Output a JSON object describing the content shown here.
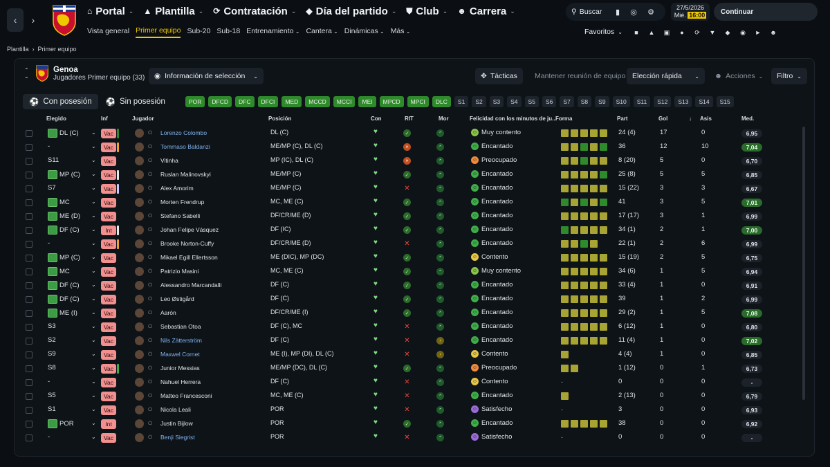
{
  "nav": {
    "main": [
      {
        "icon": "home-icon",
        "label": "Portal"
      },
      {
        "icon": "shirt-icon",
        "label": "Plantilla"
      },
      {
        "icon": "refresh-icon",
        "label": "Contratación"
      },
      {
        "icon": "diamond-icon",
        "label": "Día del partido"
      },
      {
        "icon": "shield-icon",
        "label": "Club"
      },
      {
        "icon": "person-icon",
        "label": "Carrera"
      }
    ],
    "sub": [
      "Vista general",
      "Primer equipo",
      "Sub-20",
      "Sub-18",
      "Entrenamiento",
      "Cantera",
      "Dinámicas",
      "Más"
    ],
    "sub_dropdown": [
      "Entrenamiento",
      "Cantera",
      "Dinámicas",
      "Más"
    ],
    "search": "Buscar",
    "date": "27/5/2026",
    "day": "Mié.",
    "time": "16:00",
    "continue": "Continuar",
    "favs": "Favoritos"
  },
  "breadcrumb": [
    "Plantilla",
    "Primer equipo"
  ],
  "club": {
    "name": "Genoa",
    "subtitle": "Jugadores Primer equipo (33)"
  },
  "toolbar": {
    "selinfo": "Información de selección",
    "tacticas": "Tácticas",
    "reunion": "Mantener reunión de equipo",
    "eleccion": "Elección rápida",
    "acciones": "Acciones",
    "filtro": "Filtro"
  },
  "tabs": [
    "Con posesión",
    "Sin posesión"
  ],
  "positions": [
    {
      "l": "POR",
      "on": true
    },
    {
      "l": "DFCD",
      "on": true
    },
    {
      "l": "DFC",
      "on": true
    },
    {
      "l": "DFCI",
      "on": true
    },
    {
      "l": "MED",
      "on": true
    },
    {
      "l": "MCCD",
      "on": true
    },
    {
      "l": "MCCI",
      "on": true
    },
    {
      "l": "MEI",
      "on": true
    },
    {
      "l": "MPCD",
      "on": true
    },
    {
      "l": "MPCI",
      "on": true
    },
    {
      "l": "DLC",
      "on": true
    },
    {
      "l": "S1",
      "on": false
    },
    {
      "l": "S2",
      "on": false
    },
    {
      "l": "S3",
      "on": false
    },
    {
      "l": "S4",
      "on": false
    },
    {
      "l": "S5",
      "on": false
    },
    {
      "l": "S6",
      "on": false
    },
    {
      "l": "S7",
      "on": false
    },
    {
      "l": "S8",
      "on": false
    },
    {
      "l": "S9",
      "on": false
    },
    {
      "l": "S10",
      "on": false
    },
    {
      "l": "S11",
      "on": false
    },
    {
      "l": "S12",
      "on": false
    },
    {
      "l": "S13",
      "on": false
    },
    {
      "l": "S14",
      "on": false
    },
    {
      "l": "S15",
      "on": false
    }
  ],
  "columns": {
    "elegido": "Elegido",
    "inf": "Inf",
    "jugador": "Jugador",
    "posicion": "Posición",
    "con": "Con",
    "rit": "RIT",
    "mor": "Mor",
    "felicidad": "Felicidad con los minutos de ju...",
    "forma": "Forma",
    "part": "Part",
    "gol": "Gol",
    "asis": "Asis",
    "med": "Med."
  },
  "colors": {
    "accent": "#f0c800",
    "green": "#2f8a2b",
    "inf": "#f28f8f"
  },
  "players": [
    {
      "sel": "DL (C)",
      "kit": true,
      "inf": "Vac",
      "bar": "#2f8a2b",
      "name": "Lorenzo Colombo",
      "link": true,
      "pos": "DL (C)",
      "rit": "ok",
      "mor": "up",
      "fel": "Muy contento",
      "fc": "#8bc34a",
      "form": [
        "a",
        "a",
        "a",
        "a",
        "a"
      ],
      "part": "24 (4)",
      "gol": "17",
      "asis": "0",
      "med": "6,95",
      "hi": false
    },
    {
      "sel": "-",
      "kit": false,
      "inf": "Vac",
      "bar": "#f0a030",
      "name": "Tommaso Baldanzi",
      "link": true,
      "pos": "ME/MP (C), DL (C)",
      "rit": "or",
      "mor": "up",
      "fel": "Encantado",
      "fc": "#3fae49",
      "form": [
        "a",
        "a",
        "g",
        "a",
        "g"
      ],
      "part": "36",
      "gol": "12",
      "asis": "10",
      "med": "7,04",
      "hi": true
    },
    {
      "sel": "S11",
      "kit": false,
      "inf": "Vac",
      "bar": "",
      "name": "Vitinha",
      "link": false,
      "pos": "MP (IC), DL (C)",
      "rit": "or",
      "mor": "up",
      "fel": "Preocupado",
      "fc": "#f08a3c",
      "form": [
        "a",
        "a",
        "g",
        "a",
        "a"
      ],
      "part": "8 (20)",
      "gol": "5",
      "asis": "0",
      "med": "6,70",
      "hi": false
    },
    {
      "sel": "MP (C)",
      "kit": true,
      "inf": "Vac",
      "bar": "#e8e8e8",
      "name": "Ruslan Malinovskyi",
      "link": false,
      "pos": "ME/MP (C)",
      "rit": "ok",
      "mor": "up",
      "fel": "Encantado",
      "fc": "#3fae49",
      "form": [
        "a",
        "a",
        "a",
        "a",
        "g"
      ],
      "part": "25 (8)",
      "gol": "5",
      "asis": "5",
      "med": "6,85",
      "hi": false
    },
    {
      "sel": "S7",
      "kit": false,
      "inf": "Vac",
      "bar": "#c9c9ff",
      "name": "Alex Amorim",
      "link": false,
      "pos": "ME/MP (C)",
      "rit": "no",
      "mor": "up",
      "fel": "Encantado",
      "fc": "#3fae49",
      "form": [
        "a",
        "a",
        "a",
        "a",
        "a"
      ],
      "part": "15 (22)",
      "gol": "3",
      "asis": "3",
      "med": "6,67",
      "hi": false
    },
    {
      "sel": "MC",
      "kit": true,
      "inf": "Vac",
      "bar": "",
      "name": "Morten Frendrup",
      "link": false,
      "pos": "MC, ME (C)",
      "rit": "ok",
      "mor": "up",
      "fel": "Encantado",
      "fc": "#3fae49",
      "form": [
        "g",
        "a",
        "g",
        "a",
        "g"
      ],
      "part": "41",
      "gol": "3",
      "asis": "5",
      "med": "7,01",
      "hi": true
    },
    {
      "sel": "ME (D)",
      "kit": true,
      "inf": "Vac",
      "bar": "",
      "name": "Stefano Sabelli",
      "link": false,
      "pos": "DF/CR/ME (D)",
      "rit": "ok",
      "mor": "up",
      "fel": "Encantado",
      "fc": "#3fae49",
      "form": [
        "a",
        "a",
        "a",
        "a",
        "a"
      ],
      "part": "17 (17)",
      "gol": "3",
      "asis": "1",
      "med": "6,99",
      "hi": false
    },
    {
      "sel": "DF (C)",
      "kit": true,
      "inf": "Int",
      "bar": "#e8e8e8",
      "name": "Johan Felipe Vásquez",
      "link": false,
      "pos": "DF (IC)",
      "rit": "ok",
      "mor": "up",
      "fel": "Encantado",
      "fc": "#3fae49",
      "form": [
        "g",
        "a",
        "a",
        "a",
        "a"
      ],
      "part": "34 (1)",
      "gol": "2",
      "asis": "1",
      "med": "7,00",
      "hi": true
    },
    {
      "sel": "-",
      "kit": false,
      "inf": "Vac",
      "bar": "#f0a030",
      "name": "Brooke Norton-Cuffy",
      "link": false,
      "pos": "DF/CR/ME (D)",
      "rit": "no",
      "mor": "up",
      "fel": "Encantado",
      "fc": "#3fae49",
      "form": [
        "a",
        "a",
        "g",
        "a"
      ],
      "part": "22 (1)",
      "gol": "2",
      "asis": "6",
      "med": "6,99",
      "hi": false
    },
    {
      "sel": "MP (C)",
      "kit": true,
      "inf": "Vac",
      "bar": "",
      "name": "Mikael Egill Ellertsson",
      "link": false,
      "pos": "ME (DIC), MP (DC)",
      "rit": "ok",
      "mor": "up",
      "fel": "Contento",
      "fc": "#e8c547",
      "form": [
        "a",
        "a",
        "a",
        "a",
        "a"
      ],
      "part": "15 (19)",
      "gol": "2",
      "asis": "5",
      "med": "6,75",
      "hi": false
    },
    {
      "sel": "MC",
      "kit": true,
      "inf": "Vac",
      "bar": "",
      "name": "Patrizio Masini",
      "link": false,
      "pos": "MC, ME (C)",
      "rit": "ok",
      "mor": "up",
      "fel": "Muy contento",
      "fc": "#8bc34a",
      "form": [
        "a",
        "a",
        "a",
        "a",
        "a"
      ],
      "part": "34 (6)",
      "gol": "1",
      "asis": "5",
      "med": "6,94",
      "hi": false
    },
    {
      "sel": "DF (C)",
      "kit": true,
      "inf": "Vac",
      "bar": "",
      "name": "Alessandro Marcandalli",
      "link": false,
      "pos": "DF (C)",
      "rit": "ok",
      "mor": "up",
      "fel": "Encantado",
      "fc": "#3fae49",
      "form": [
        "a",
        "a",
        "a",
        "a",
        "a"
      ],
      "part": "33 (4)",
      "gol": "1",
      "asis": "0",
      "med": "6,91",
      "hi": false
    },
    {
      "sel": "DF (C)",
      "kit": true,
      "inf": "Vac",
      "bar": "",
      "name": "Leo Østigård",
      "link": false,
      "pos": "DF (C)",
      "rit": "ok",
      "mor": "up",
      "fel": "Encantado",
      "fc": "#3fae49",
      "form": [
        "a",
        "a",
        "a",
        "a",
        "a"
      ],
      "part": "39",
      "gol": "1",
      "asis": "2",
      "med": "6,99",
      "hi": false
    },
    {
      "sel": "ME (I)",
      "kit": true,
      "inf": "Vac",
      "bar": "",
      "name": "Aarón",
      "link": false,
      "pos": "DF/CR/ME (I)",
      "rit": "ok",
      "mor": "up",
      "fel": "Encantado",
      "fc": "#3fae49",
      "form": [
        "a",
        "a",
        "a",
        "a",
        "a"
      ],
      "part": "29 (2)",
      "gol": "1",
      "asis": "5",
      "med": "7,08",
      "hi": true
    },
    {
      "sel": "S3",
      "kit": false,
      "inf": "Vac",
      "bar": "",
      "name": "Sebastian Otoa",
      "link": false,
      "pos": "DF (C), MC",
      "rit": "no",
      "mor": "up",
      "fel": "Encantado",
      "fc": "#3fae49",
      "form": [
        "a",
        "a",
        "a",
        "a",
        "a"
      ],
      "part": "6 (12)",
      "gol": "1",
      "asis": "0",
      "med": "6,80",
      "hi": false
    },
    {
      "sel": "S2",
      "kit": false,
      "inf": "Vac",
      "bar": "",
      "name": "Nils Zätterström",
      "link": true,
      "pos": "DF (C)",
      "rit": "no",
      "mor": "y",
      "fel": "Encantado",
      "fc": "#3fae49",
      "form": [
        "a",
        "a",
        "a",
        "a",
        "a"
      ],
      "part": "11 (4)",
      "gol": "1",
      "asis": "0",
      "med": "7,02",
      "hi": true
    },
    {
      "sel": "S9",
      "kit": false,
      "inf": "Vac",
      "bar": "",
      "name": "Maxwel Cornet",
      "link": true,
      "pos": "ME (I), MP (DI), DL (C)",
      "rit": "no",
      "mor": "y",
      "fel": "Contento",
      "fc": "#e8c547",
      "form": [
        "a"
      ],
      "part": "4 (4)",
      "gol": "1",
      "asis": "0",
      "med": "6,85",
      "hi": false
    },
    {
      "sel": "S8",
      "kit": false,
      "inf": "Vac",
      "bar": "#3fae49",
      "name": "Junior Messias",
      "link": false,
      "pos": "ME/MP (DC), DL (C)",
      "rit": "ok",
      "mor": "up",
      "fel": "Preocupado",
      "fc": "#f08a3c",
      "form": [
        "a",
        "a"
      ],
      "part": "1 (12)",
      "gol": "0",
      "asis": "1",
      "med": "6,73",
      "hi": false
    },
    {
      "sel": "-",
      "kit": false,
      "inf": "Vac",
      "bar": "",
      "name": "Nahuel Herrera",
      "link": false,
      "pos": "DF (C)",
      "rit": "no",
      "mor": "up",
      "fel": "Contento",
      "fc": "#e8c547",
      "form": [],
      "part": "0",
      "gol": "0",
      "asis": "0",
      "med": "-",
      "hi": false
    },
    {
      "sel": "S5",
      "kit": false,
      "inf": "Vac",
      "bar": "",
      "name": "Matteo Francesconi",
      "link": false,
      "pos": "MC, ME (C)",
      "rit": "no",
      "mor": "up",
      "fel": "Encantado",
      "fc": "#3fae49",
      "form": [
        "a"
      ],
      "part": "2 (13)",
      "gol": "0",
      "asis": "0",
      "med": "6,79",
      "hi": false
    },
    {
      "sel": "S1",
      "kit": false,
      "inf": "Vac",
      "bar": "",
      "name": "Nicola Leali",
      "link": false,
      "pos": "POR",
      "rit": "no",
      "mor": "up",
      "fel": "Satisfecho",
      "fc": "#9b6cd8",
      "form": [],
      "part": "3",
      "gol": "0",
      "asis": "0",
      "med": "6,93",
      "hi": false
    },
    {
      "sel": "POR",
      "kit": true,
      "inf": "Int",
      "bar": "",
      "name": "Justin Bijlow",
      "link": false,
      "pos": "POR",
      "rit": "ok",
      "mor": "up",
      "fel": "Encantado",
      "fc": "#3fae49",
      "form": [
        "a",
        "a",
        "a",
        "a",
        "a"
      ],
      "part": "38",
      "gol": "0",
      "asis": "0",
      "med": "6,92",
      "hi": false
    },
    {
      "sel": "-",
      "kit": false,
      "inf": "Vac",
      "bar": "",
      "name": "Benji Siegrist",
      "link": true,
      "pos": "POR",
      "rit": "no",
      "mor": "up",
      "fel": "Satisfecho",
      "fc": "#9b6cd8",
      "form": [],
      "part": "0",
      "gol": "0",
      "asis": "0",
      "med": "-",
      "hi": false
    }
  ]
}
